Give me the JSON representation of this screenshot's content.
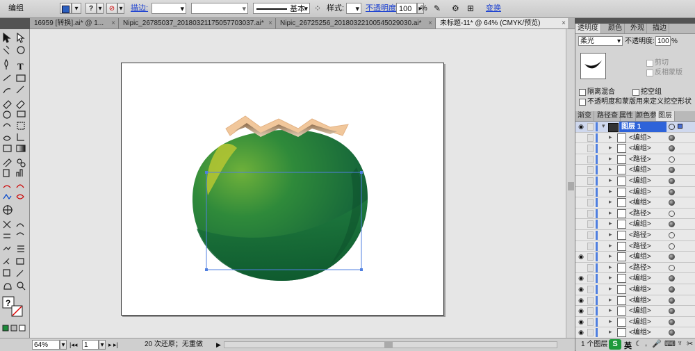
{
  "control_bar": {
    "object_type": "编组",
    "stroke_label": "描边:",
    "stroke_weight": "",
    "stroke_style_value": "",
    "brush_label": "基本",
    "style_label": "样式:",
    "opacity_label": "不透明度:",
    "opacity_value": "100",
    "percent": "%",
    "transform_label": "变换"
  },
  "doc_tabs": [
    {
      "label": "16959 [转换].ai* @ 1..."
    },
    {
      "label": "Nipic_26785037_20180321175057703037.ai*"
    },
    {
      "label": "Nipic_26725256_20180322100545029030.ai*"
    },
    {
      "label": "未标题-11* @ 64% (CMYK/预览)"
    }
  ],
  "tab_close": "×",
  "transparency_panel": {
    "tabs": [
      "透明度",
      "颜色",
      "外观",
      "描边"
    ],
    "blend_mode": "柔光",
    "opacity_label": "不透明度:",
    "opacity_value": "100",
    "percent": "%",
    "clip_label": "剪切",
    "invert_mask_label": "反相蒙版",
    "isolate_blending_label": "隔离混合",
    "knockout_group_label": "挖空组",
    "opacity_mask_knockout_label": "不透明度和蒙版用来定义挖空形状"
  },
  "layers_panel": {
    "tabs": [
      "渐变",
      "路径查",
      "属性",
      "颜色参",
      "图层"
    ],
    "layer_name": "图层 1",
    "items": [
      {
        "name": "<编组>",
        "visible": false,
        "filled": true
      },
      {
        "name": "<编组>",
        "visible": false,
        "filled": true
      },
      {
        "name": "<路径>",
        "visible": false,
        "filled": false
      },
      {
        "name": "<编组>",
        "visible": false,
        "filled": true
      },
      {
        "name": "<编组>",
        "visible": false,
        "filled": true
      },
      {
        "name": "<编组>",
        "visible": false,
        "filled": true
      },
      {
        "name": "<编组>",
        "visible": false,
        "filled": true
      },
      {
        "name": "<路径>",
        "visible": false,
        "filled": false
      },
      {
        "name": "<编组>",
        "visible": false,
        "filled": true
      },
      {
        "name": "<路径>",
        "visible": false,
        "filled": false
      },
      {
        "name": "<路径>",
        "visible": false,
        "filled": false
      },
      {
        "name": "<编组>",
        "visible": true,
        "filled": true
      },
      {
        "name": "<路径>",
        "visible": false,
        "filled": false
      },
      {
        "name": "<编组>",
        "visible": true,
        "filled": true
      },
      {
        "name": "<编组>",
        "visible": true,
        "filled": true
      },
      {
        "name": "<编组>",
        "visible": true,
        "filled": true
      },
      {
        "name": "<编组>",
        "visible": true,
        "filled": true
      },
      {
        "name": "<编组>",
        "visible": true,
        "filled": true
      },
      {
        "name": "<编组>",
        "visible": true,
        "filled": true
      }
    ],
    "footer": "1 个图层"
  },
  "status_bar": {
    "zoom": "64%",
    "page": "1",
    "undo_text": "20 次还原；无重做"
  },
  "ime": {
    "logo": "S",
    "lang": "英"
  },
  "colors": {
    "accent_blue": "#4a6fd1",
    "coconut_dark": "#0e5a2e",
    "coconut_mid": "#2f8a3a",
    "coconut_light": "#9fbf2c",
    "husk": "#f1c79b",
    "selection": "#4f7fe0"
  }
}
